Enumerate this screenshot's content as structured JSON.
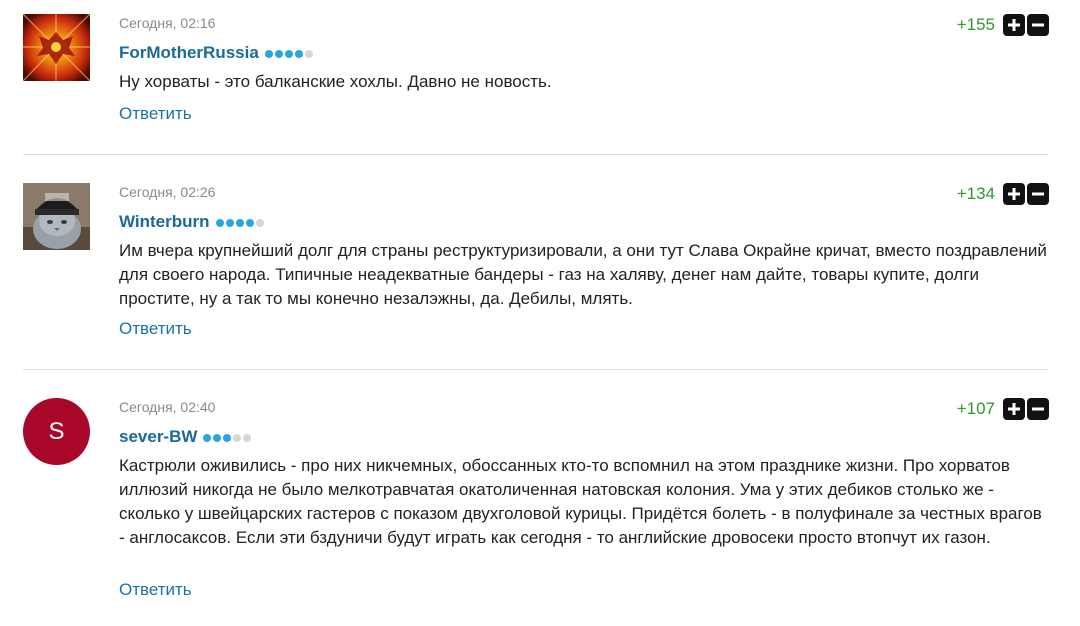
{
  "reply_label": "Ответить",
  "colors": {
    "username": "#1a6a9a",
    "score": "#2a9a2a",
    "reply": "#1a73a8",
    "dot_on": "#2aa4e0",
    "dot_off": "#d6d6d6",
    "avatar_s_bg": "#a8072a"
  },
  "comments": [
    {
      "timestamp": "Сегодня, 02:16",
      "username": "ForMotherRussia",
      "rank_level": 4,
      "rank_max": 5,
      "score": "+155",
      "text": "Ну хорваты - это балканские хохлы. Давно не новость.",
      "avatar_icon": "russian-eagle-emblem-avatar"
    },
    {
      "timestamp": "Сегодня, 02:26",
      "username": "Winterburn",
      "rank_level": 4,
      "rank_max": 5,
      "score": "+134",
      "text": "Им вчера крупнейший долг для страны реструктуризировали, а они тут Слава Окрайне кричат, вместо поздравлений для своего народа. Типичные неадекватные бандеры - газ на халяву, денег нам дайте, товары купите, долги простите, ну а так то мы конечно незалэжны, да. Дебилы, млять.",
      "avatar_icon": "cat-in-hat-avatar"
    },
    {
      "timestamp": "Сегодня, 02:40",
      "username": "sever-BW",
      "rank_level": 3,
      "rank_max": 5,
      "score": "+107",
      "text": "Кастрюли оживились - про них никчемных, обоссанных кто-то вспомнил на этом празднике жизни. Про хорватов иллюзий никогда не было мелкотравчатая окатоличенная натовская колония. Ума у этих дебиков столько же - сколько у швейцарских гастеров с показом двухголовой курицы. Придётся болеть - в полуфинале за честных врагов - англосаксов. Если эти бздуничи будут играть как сегодня - то английские дровосеки просто втопчут их газон.",
      "avatar_letter": "S"
    }
  ]
}
